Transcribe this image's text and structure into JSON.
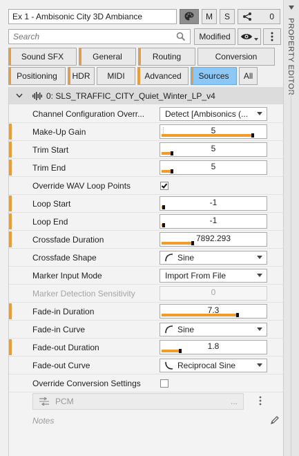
{
  "header": {
    "title": "Ex 1 - Ambisonic City 3D Ambiance",
    "m_label": "M",
    "s_label": "S",
    "share_count": "0",
    "search_placeholder": "Search",
    "modified_label": "Modified"
  },
  "side_panel_label": "PROPERTY EDITOR",
  "tabs": {
    "row1": [
      "Sound SFX",
      "General",
      "Routing",
      "Conversion"
    ],
    "row2": [
      "Positioning",
      "HDR",
      "MIDI",
      "Advanced",
      "Sources",
      "All"
    ],
    "active": "Sources"
  },
  "object": {
    "name": "0: SLS_TRAFFIC_CITY_Quiet_Winter_LP_v4"
  },
  "properties": [
    {
      "label": "Channel Configuration Overr...",
      "type": "dropdown",
      "value": "Detect [Ambisonics (..."
    },
    {
      "label": "Make-Up Gain",
      "type": "slider",
      "value": "5",
      "level": 0.88
    },
    {
      "label": "Trim Start",
      "type": "slider",
      "value": "5",
      "level": 0.1
    },
    {
      "label": "Trim End",
      "type": "slider",
      "value": "5",
      "level": 0.1
    },
    {
      "label": "Override WAV Loop Points",
      "type": "checkbox",
      "checked": true
    },
    {
      "label": "Loop Start",
      "type": "slider",
      "value": "-1",
      "level": 0.02
    },
    {
      "label": "Loop End",
      "type": "slider",
      "value": "-1",
      "level": 0.02
    },
    {
      "label": "Crossfade Duration",
      "type": "slider",
      "value": "7892.293",
      "level": 0.3
    },
    {
      "label": "Crossfade Shape",
      "type": "dropdown",
      "value": "Sine",
      "icon": "sine"
    },
    {
      "label": "Marker Input Mode",
      "type": "dropdown",
      "value": "Import From File"
    },
    {
      "label": "Marker Detection Sensitivity",
      "type": "slider",
      "value": "0",
      "level": 0,
      "disabled": true
    },
    {
      "label": "Fade-in Duration",
      "type": "slider",
      "value": "7.3",
      "level": 0.73
    },
    {
      "label": "Fade-in Curve",
      "type": "dropdown",
      "value": "Sine",
      "icon": "sine"
    },
    {
      "label": "Fade-out Duration",
      "type": "slider",
      "value": "1.8",
      "level": 0.18
    },
    {
      "label": "Fade-out Curve",
      "type": "dropdown",
      "value": "Reciprocal Sine",
      "icon": "recip-sine"
    },
    {
      "label": "Override Conversion Settings",
      "type": "checkbox",
      "checked": false
    }
  ],
  "conversion": {
    "value": "PCM",
    "ellipsis": "..."
  },
  "notes_placeholder": "Notes",
  "colors": {
    "accent": "#f29b2c",
    "active_tab": "#8cc7f5"
  }
}
